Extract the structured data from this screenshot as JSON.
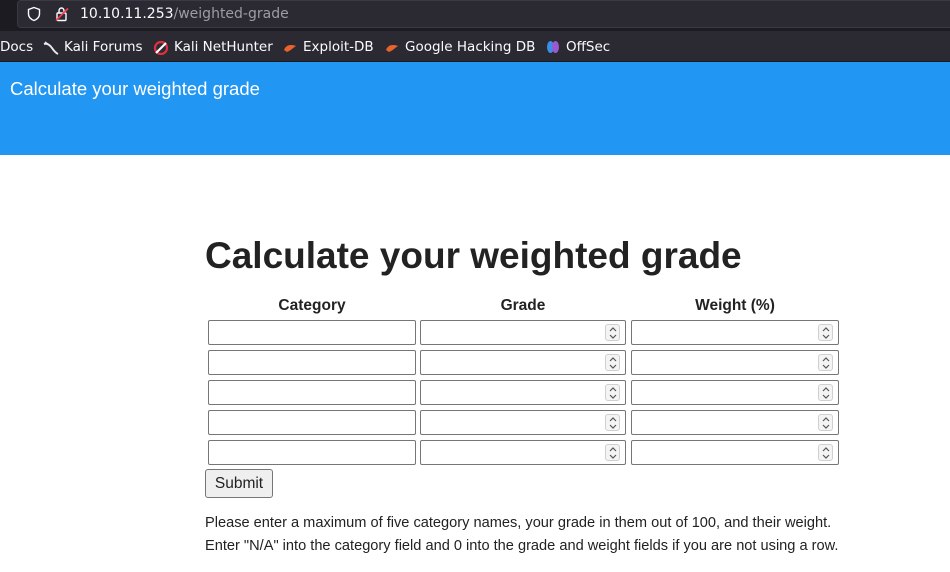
{
  "browser": {
    "url_host": "10.10.11.253",
    "url_path": "/weighted-grade",
    "bookmarks": [
      {
        "label": "Docs",
        "icon": "none"
      },
      {
        "label": "Kali Forums",
        "icon": "kali-dragon-icon"
      },
      {
        "label": "Kali NetHunter",
        "icon": "nethunter-icon"
      },
      {
        "label": "Exploit-DB",
        "icon": "exploit-db-icon"
      },
      {
        "label": "Google Hacking DB",
        "icon": "ghdb-icon"
      },
      {
        "label": "OffSec",
        "icon": "offsec-icon"
      }
    ]
  },
  "navbar": {
    "title": "Calculate your weighted grade",
    "color": "#2196f3"
  },
  "main": {
    "heading": "Calculate your weighted grade",
    "columns": [
      "Category",
      "Grade",
      "Weight (%)"
    ],
    "rows": [
      {
        "category": "",
        "grade": "",
        "weight": ""
      },
      {
        "category": "",
        "grade": "",
        "weight": ""
      },
      {
        "category": "",
        "grade": "",
        "weight": ""
      },
      {
        "category": "",
        "grade": "",
        "weight": ""
      },
      {
        "category": "",
        "grade": "",
        "weight": ""
      }
    ],
    "submit_label": "Submit",
    "instructions": [
      "Please enter a maximum of five category names, your grade in them out of 100, and their weight.",
      "Enter \"N/A\" into the category field and 0 into the grade and weight fields if you are not using a row."
    ]
  }
}
